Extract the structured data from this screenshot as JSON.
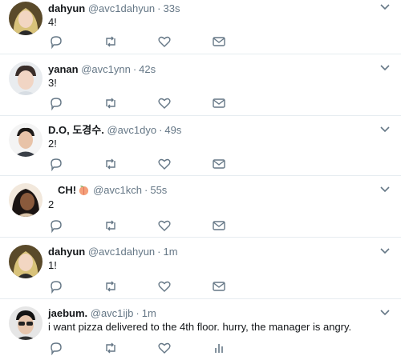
{
  "timeline": {
    "tweets": [
      {
        "name": "dahyun",
        "handle": "@avc1dahyun",
        "separator": "·",
        "time": "33s",
        "text": "4!",
        "emoji": "",
        "avatar": "dahyun-avatar",
        "last_action": "mail-icon"
      },
      {
        "name": "yanan",
        "handle": "@avc1ynn",
        "separator": "·",
        "time": "42s",
        "text": "3!",
        "emoji": "",
        "avatar": "yanan-avatar",
        "last_action": "mail-icon"
      },
      {
        "name": "D.O, 도경수.",
        "handle": "@avc1dyo",
        "separator": "·",
        "time": "49s",
        "text": "2!",
        "emoji": "",
        "avatar": "do-avatar",
        "last_action": "mail-icon"
      },
      {
        "name": "CH!",
        "handle": "@avc1kch",
        "separator": "·",
        "time": "55s",
        "text": "2",
        "emoji": "peach-emoji",
        "avatar": "ch-avatar",
        "last_action": "mail-icon"
      },
      {
        "name": "dahyun",
        "handle": "@avc1dahyun",
        "separator": "·",
        "time": "1m",
        "text": "1!",
        "emoji": "",
        "avatar": "dahyun-avatar",
        "last_action": "mail-icon"
      },
      {
        "name": "jaebum.",
        "handle": "@avc1ijb",
        "separator": "·",
        "time": "1m",
        "text": "i want pizza delivered to the 4th floor. hurry, the manager is angry.",
        "emoji": "",
        "avatar": "jaebum-avatar",
        "last_action": "analytics-icon"
      }
    ]
  },
  "icons": {
    "reply": "reply-icon",
    "retweet": "retweet-icon",
    "like": "heart-icon",
    "message": "mail-icon",
    "analytics": "analytics-icon",
    "more": "chevron-down-icon"
  },
  "colors": {
    "icon": "#657786",
    "border": "#e6ecf0",
    "text": "#14171a",
    "muted": "#657786"
  }
}
